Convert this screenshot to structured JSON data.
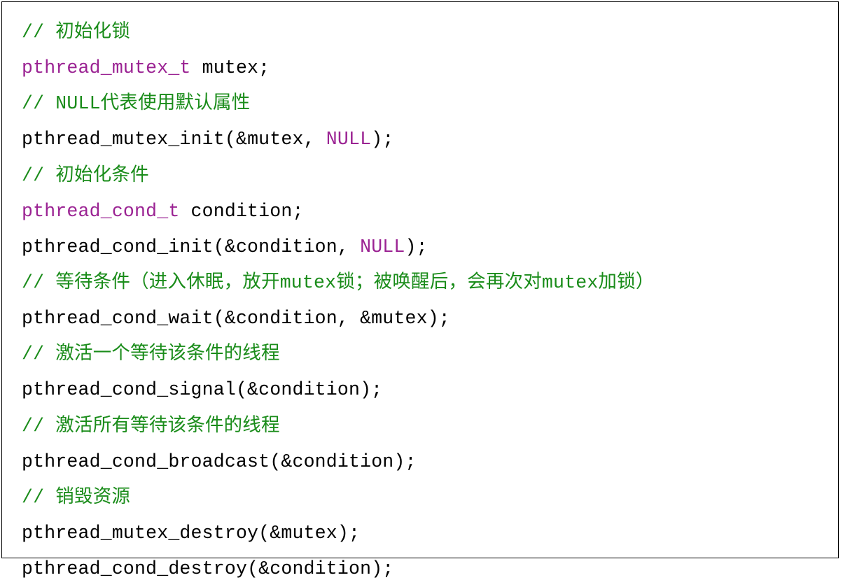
{
  "code": {
    "line1": {
      "comment": "// 初始化锁"
    },
    "line2": {
      "type": "pthread_mutex_t",
      "ident": " mutex;"
    },
    "line3": {
      "comment": "// NULL代表使用默认属性"
    },
    "line4": {
      "func": "pthread_mutex_init",
      "punct1": "(&mutex, ",
      "const": "NULL",
      "punct2": ");"
    },
    "line5": {
      "comment": "// 初始化条件"
    },
    "line6": {
      "type": "pthread_cond_t",
      "ident": " condition;"
    },
    "line7": {
      "func": "pthread_cond_init",
      "punct1": "(&condition, ",
      "const": "NULL",
      "punct2": ");"
    },
    "line8": {
      "comment": "// 等待条件（进入休眠，放开mutex锁；被唤醒后，会再次对mutex加锁）"
    },
    "line9": {
      "func": "pthread_cond_wait",
      "punct": "(&condition, &mutex);"
    },
    "line10": {
      "comment": "// 激活一个等待该条件的线程"
    },
    "line11": {
      "func": "pthread_cond_signal",
      "punct": "(&condition);"
    },
    "line12": {
      "comment": "// 激活所有等待该条件的线程"
    },
    "line13": {
      "func": "pthread_cond_broadcast",
      "punct": "(&condition);"
    },
    "line14": {
      "comment": "// 销毁资源"
    },
    "line15": {
      "func": "pthread_mutex_destroy",
      "punct": "(&mutex);"
    },
    "line16": {
      "func": "pthread_cond_destroy",
      "punct": "(&condition);"
    }
  }
}
